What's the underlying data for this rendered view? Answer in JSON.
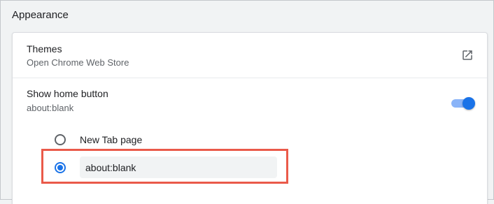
{
  "section": {
    "title": "Appearance"
  },
  "themes": {
    "label": "Themes",
    "sublabel": "Open Chrome Web Store",
    "icon": "open-in-new-icon"
  },
  "home_button": {
    "label": "Show home button",
    "sublabel": "about:blank",
    "toggle_on": true
  },
  "home_options": {
    "new_tab_label": "New Tab page",
    "new_tab_selected": false,
    "custom_url_selected": true,
    "custom_url_value": "about:blank"
  },
  "colors": {
    "accent": "#1a73e8",
    "highlight": "#ea5a4a"
  }
}
